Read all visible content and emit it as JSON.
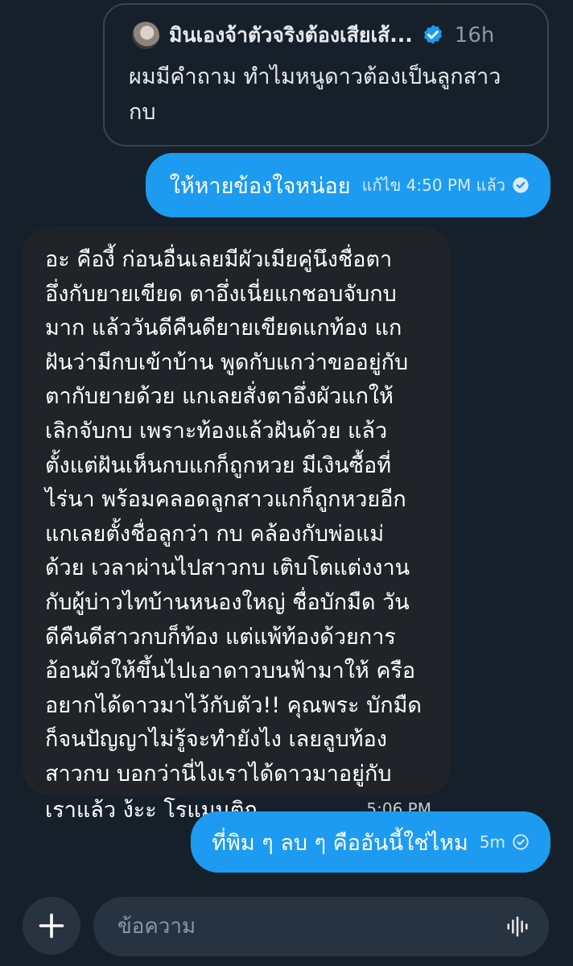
{
  "quoted_tweet": {
    "author_name": "มินเองจ้าตัวจริงต้องเสียเส้...",
    "verified": true,
    "time": "16h",
    "text": "ผมมีคำถาม ทำไมหนูดาวต้องเป็นลูกสาวกบ"
  },
  "messages": [
    {
      "direction": "outgoing",
      "text": "ให้หายข้องใจหน่อย",
      "meta": "แก้ไข 4:50 PM แล้ว",
      "status_icon": "check-circle-icon"
    },
    {
      "direction": "incoming",
      "lines": [
        "อะ คืองี้ ก่อนอื่นเลยมีผัวเมียคู่นึงชื่อตา",
        "อึ่งกับยายเขียด ตาอึ่งเนี่ยแกชอบจับกบ",
        "มาก แล้ววันดีคืนดียายเขียดแกท้อง แก",
        "ฝันว่ามีกบเข้าบ้าน พูดกับแกว่าขออยู่กับ",
        "ตากับยายด้วย แกเลยสั่งตาอึ่งผัวแกให้",
        "เลิกจับกบ เพราะท้องแล้วฝันด้วย แล้ว",
        "ตั้งแต่ฝันเห็นกบแกก็ถูกหวย มีเงินซื้อที่",
        "ไร่นา พร้อมคลอดลูกสาวแกก็ถูกหวยอีก",
        "แกเลยตั้งชื่อลูกว่า กบ คล้องกับพ่อแม่",
        "ด้วย เวลาผ่านไปสาวกบ เติบโตแต่งงาน",
        "กับผู้บ่าวไทบ้านหนองใหญ่ ชื่อบักมืด วัน",
        "ดีคืนดีสาวกบก็ท้อง แต่แพ้ท้องด้วยการ",
        "อ้อนผัวให้ขึ้นไปเอาดาวบนฟ้ามาให้ ครือ",
        "อยากได้ดาวมาไว้กับตัว!! คุณพระ บักมืด",
        "ก็จนปัญญาไม่รู้จะทำยังไง เลยลูบท้อง",
        "สาวกบ บอกว่านี่ไงเราได้ดาวมาอยู่กับ",
        "เราแล้ว ง้ะะ โรแมนติก"
      ],
      "time": "5:06 PM"
    },
    {
      "direction": "outgoing",
      "text": "ที่พิม ๆ ลบ ๆ คืออันนี้ใช่ไหม",
      "meta": "5m",
      "status_icon": "check-circle-outline-icon"
    }
  ],
  "composer": {
    "placeholder": "ข้อความ",
    "value": "",
    "add_icon": "plus-icon",
    "voice_icon": "voice-waveform-icon"
  },
  "colors": {
    "background": "#15202b",
    "outgoing_bubble": "#1d9bf0",
    "incoming_bubble": "#202327",
    "verified_badge": "#1d9bf0",
    "muted_text": "#8b98a5"
  }
}
